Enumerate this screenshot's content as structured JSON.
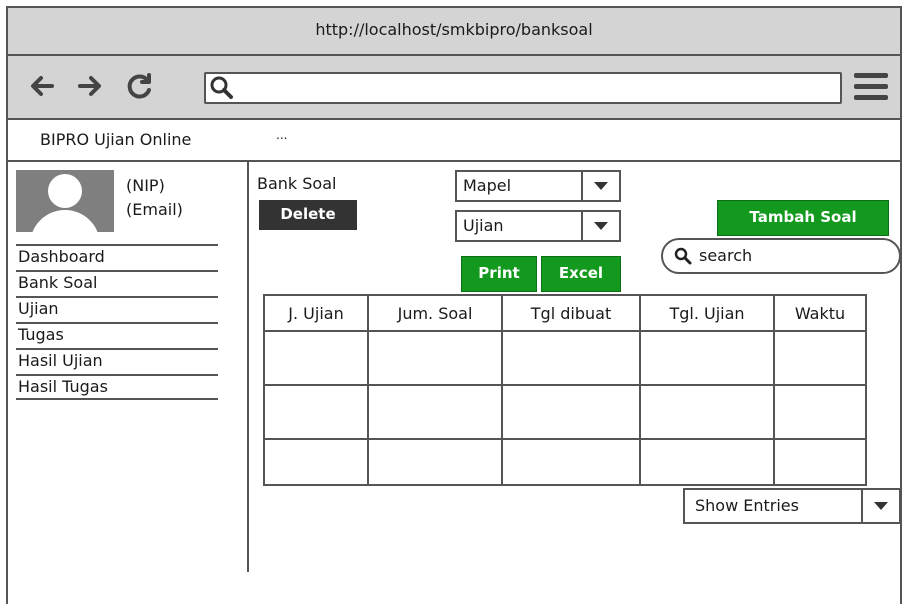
{
  "browser": {
    "url_title": "http://localhost/smkbipro/banksoal",
    "back_icon": "back-arrow-icon",
    "forward_icon": "forward-arrow-icon",
    "reload_icon": "reload-icon",
    "search_icon": "search-icon",
    "menu_icon": "hamburger-menu-icon",
    "address_value": ""
  },
  "app": {
    "title": "BIPRO Ujian Online",
    "extra": "..."
  },
  "profile": {
    "nip": "(NIP)",
    "email": "(Email)"
  },
  "sidebar": {
    "items": [
      {
        "label": "Dashboard"
      },
      {
        "label": "Bank Soal"
      },
      {
        "label": "Ujian"
      },
      {
        "label": "Tugas"
      },
      {
        "label": "Hasil Ujian"
      },
      {
        "label": "Hasil Tugas"
      }
    ]
  },
  "main": {
    "heading": "Bank Soal",
    "delete_label": "Delete",
    "mapel_select": "Mapel",
    "ujian_select": "Ujian",
    "tambah_label": "Tambah Soal",
    "search_placeholder": "search",
    "print_label": "Print",
    "excel_label": "Excel",
    "show_entries_label": "Show Entries"
  },
  "table": {
    "headers": [
      "J. Ujian",
      "Jum. Soal",
      "Tgl dibuat",
      "Tgl. Ujian",
      "Waktu"
    ],
    "rows": [
      [
        "",
        "",
        "",
        "",
        ""
      ],
      [
        "",
        "",
        "",
        "",
        ""
      ],
      [
        "",
        "",
        "",
        "",
        ""
      ]
    ]
  },
  "colors": {
    "green_button": "#139a1e",
    "dark_button": "#333333",
    "chrome_gray": "#d4d4d4"
  }
}
